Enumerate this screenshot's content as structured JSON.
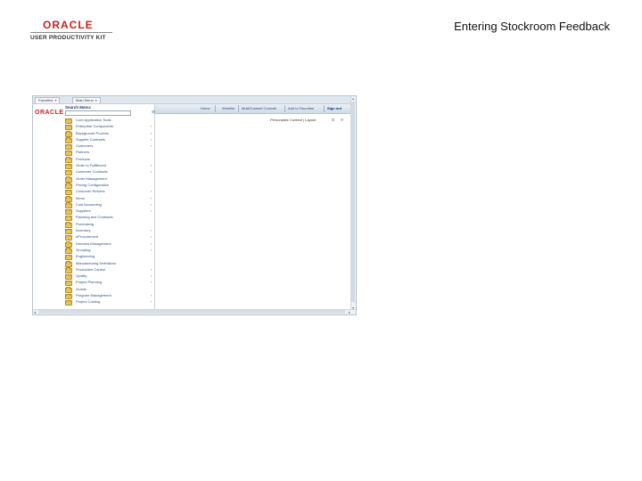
{
  "header": {
    "logo_word": "ORACLE",
    "logo_sub": "USER PRODUCTIVITY KIT",
    "slide_title": "Entering Stockroom Feedback"
  },
  "app": {
    "tabs": [
      {
        "label": "Favorites"
      },
      {
        "label": "Main Menu"
      }
    ],
    "brand": "ORACLE",
    "nav_links": [
      "Home",
      "Worklist",
      "MultiChannel Console",
      "Add to Favorites",
      "Sign out"
    ],
    "personalize": "Personalize Content | Layout",
    "menu": {
      "title": "Search Menu:",
      "items": [
        {
          "label": "Core Application Tools",
          "arrow": false
        },
        {
          "label": "Enterprise Components",
          "arrow": true
        },
        {
          "label": "Background Process",
          "arrow": true
        },
        {
          "label": "Supplier Contracts",
          "arrow": true
        },
        {
          "label": "Customers",
          "arrow": true
        },
        {
          "label": "Partners",
          "arrow": false
        },
        {
          "label": "Products",
          "arrow": false
        },
        {
          "label": "Order to Fulfillment",
          "arrow": true
        },
        {
          "label": "Customer Contracts",
          "arrow": true
        },
        {
          "label": "Order Management",
          "arrow": false
        },
        {
          "label": "Pricing Configuration",
          "arrow": false
        },
        {
          "label": "Customer Returns",
          "arrow": true
        },
        {
          "label": "Items",
          "arrow": true
        },
        {
          "label": "Cost Accounting",
          "arrow": true
        },
        {
          "label": "Suppliers",
          "arrow": true
        },
        {
          "label": "Planning and Contracts",
          "arrow": false
        },
        {
          "label": "Purchasing",
          "arrow": false
        },
        {
          "label": "Inventory",
          "arrow": true
        },
        {
          "label": "eProcurement",
          "arrow": true
        },
        {
          "label": "Demand Management",
          "arrow": true
        },
        {
          "label": "Grouping",
          "arrow": true
        },
        {
          "label": "Engineering",
          "arrow": false
        },
        {
          "label": "Manufacturing Definitions",
          "arrow": false
        },
        {
          "label": "Production Control",
          "arrow": true
        },
        {
          "label": "Quality",
          "arrow": true
        },
        {
          "label": "Project Planning",
          "arrow": true
        },
        {
          "label": "Grants",
          "arrow": false
        },
        {
          "label": "Program Management",
          "arrow": true
        },
        {
          "label": "Project Costing",
          "arrow": true
        }
      ]
    }
  }
}
